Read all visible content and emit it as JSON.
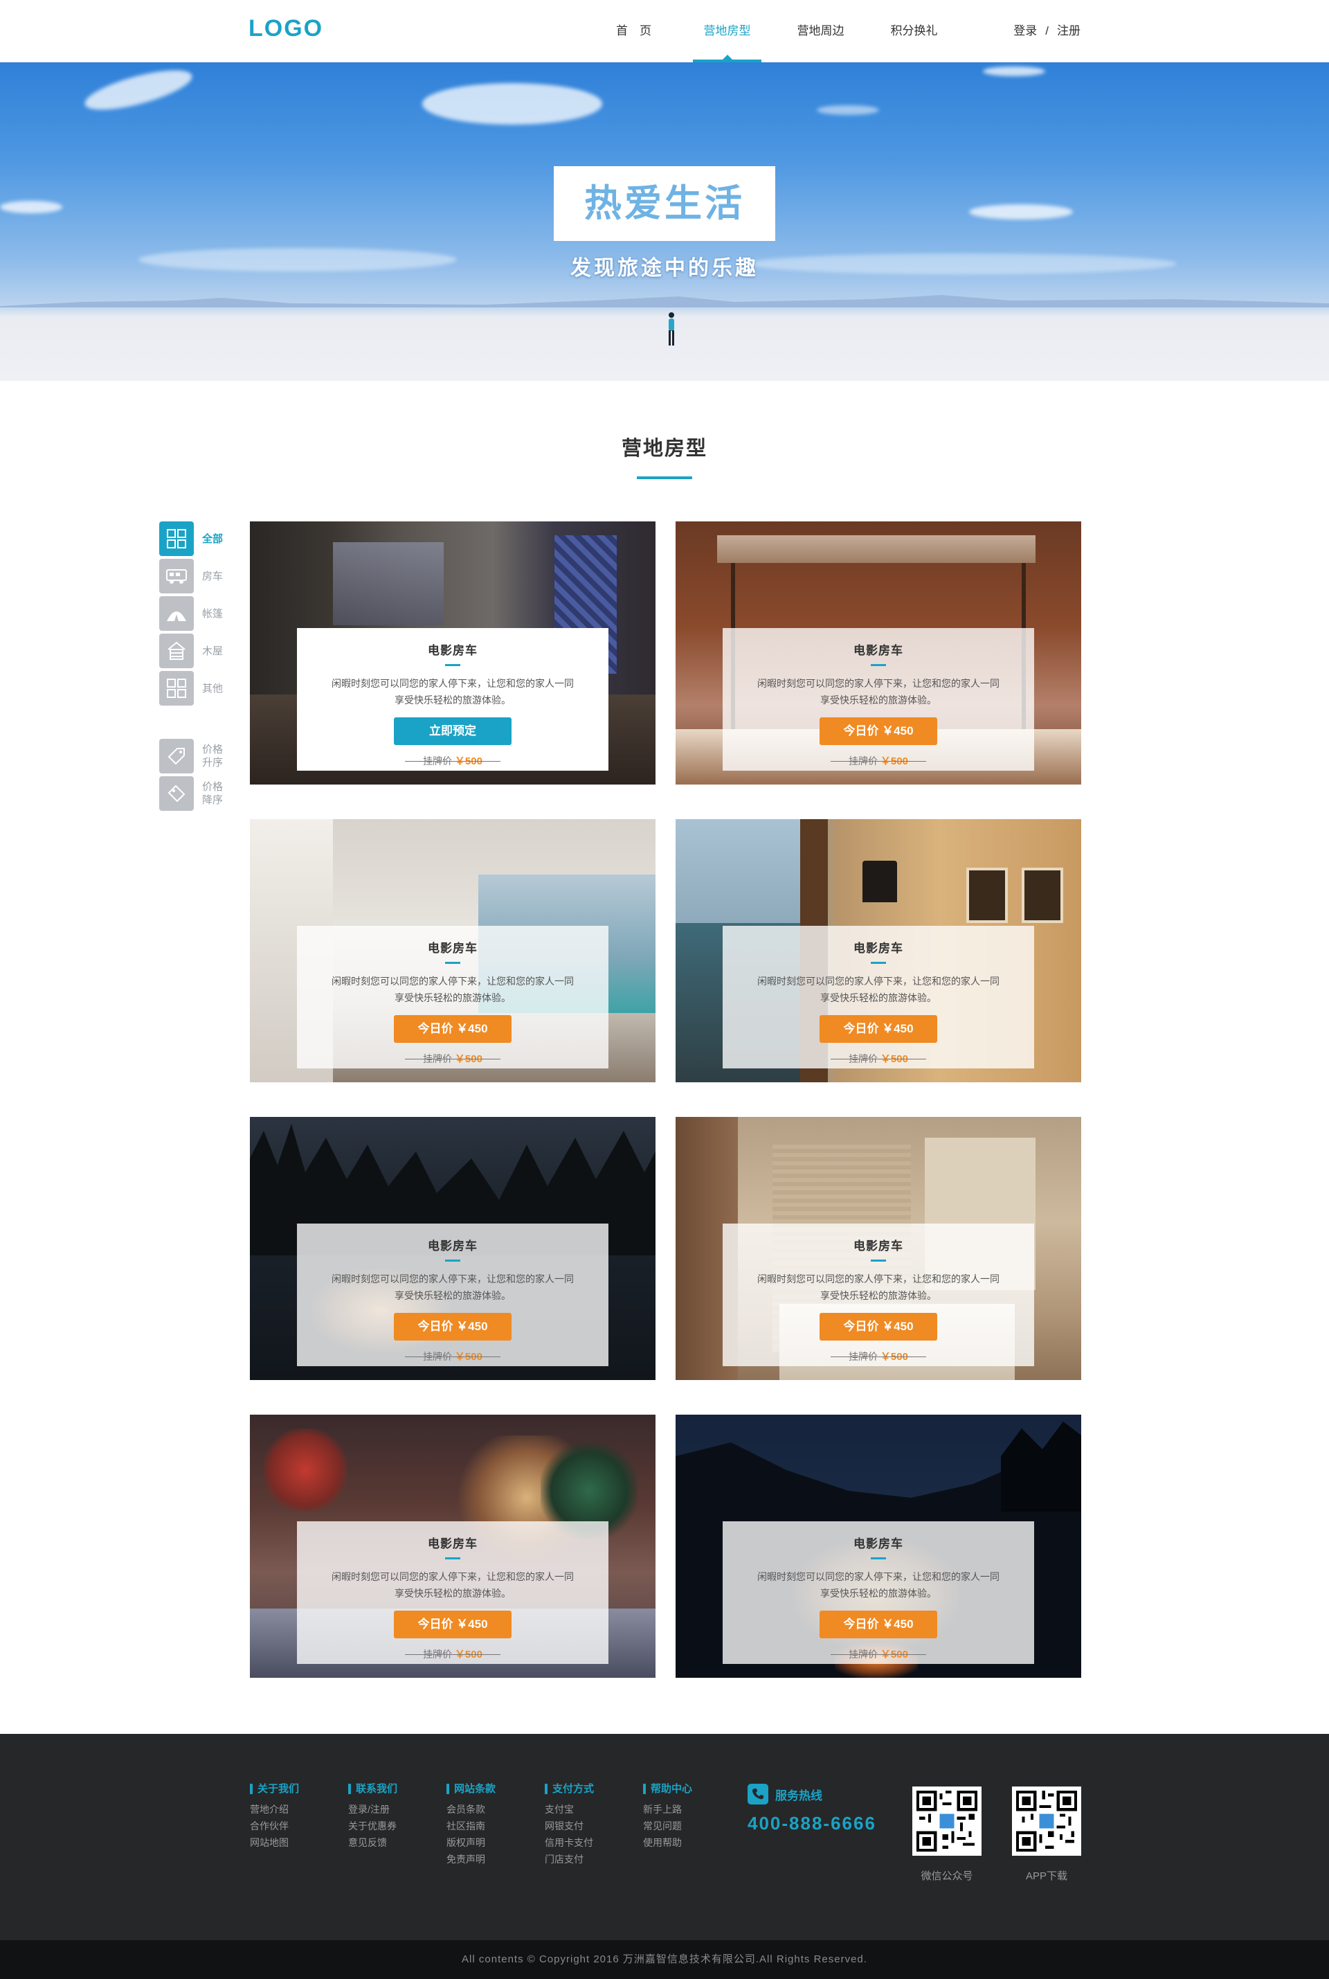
{
  "header": {
    "logo": "LOGO",
    "nav": [
      "首　页",
      "营地房型",
      "营地周边",
      "积分换礼"
    ],
    "login": "登录",
    "separator": "/",
    "register": "注册"
  },
  "hero": {
    "title": "热爱生活",
    "subtitle": "发现旅途中的乐趣"
  },
  "section": {
    "title": "营地房型"
  },
  "filters": [
    {
      "label": "全部",
      "icon": "grid-icon"
    },
    {
      "label": "房车",
      "icon": "rv-icon"
    },
    {
      "label": "帐篷",
      "icon": "tent-icon"
    },
    {
      "label": "木屋",
      "icon": "cabin-icon"
    },
    {
      "label": "其他",
      "icon": "grid-icon"
    },
    {
      "label": "价格升序",
      "icon": "price-tag-icon"
    },
    {
      "label": "价格降序",
      "icon": "price-tag-icon"
    }
  ],
  "cards": [
    {
      "title": "电影房车",
      "desc": "闲暇时刻您可以同您的家人停下来，让您和您的家人一同享受快乐轻松的旅游体验。",
      "button": "立即预定",
      "orig_label": "挂牌价",
      "orig_price": "￥500"
    },
    {
      "title": "电影房车",
      "desc": "闲暇时刻您可以同您的家人停下来，让您和您的家人一同享受快乐轻松的旅游体验。",
      "button": "今日价 ￥450",
      "orig_label": "挂牌价",
      "orig_price": "￥500"
    },
    {
      "title": "电影房车",
      "desc": "闲暇时刻您可以同您的家人停下来，让您和您的家人一同享受快乐轻松的旅游体验。",
      "button": "今日价 ￥450",
      "orig_label": "挂牌价",
      "orig_price": "￥500"
    },
    {
      "title": "电影房车",
      "desc": "闲暇时刻您可以同您的家人停下来，让您和您的家人一同享受快乐轻松的旅游体验。",
      "button": "今日价 ￥450",
      "orig_label": "挂牌价",
      "orig_price": "￥500"
    },
    {
      "title": "电影房车",
      "desc": "闲暇时刻您可以同您的家人停下来，让您和您的家人一同享受快乐轻松的旅游体验。",
      "button": "今日价 ￥450",
      "orig_label": "挂牌价",
      "orig_price": "￥500"
    },
    {
      "title": "电影房车",
      "desc": "闲暇时刻您可以同您的家人停下来，让您和您的家人一同享受快乐轻松的旅游体验。",
      "button": "今日价 ￥450",
      "orig_label": "挂牌价",
      "orig_price": "￥500"
    },
    {
      "title": "电影房车",
      "desc": "闲暇时刻您可以同您的家人停下来，让您和您的家人一同享受快乐轻松的旅游体验。",
      "button": "今日价 ￥450",
      "orig_label": "挂牌价",
      "orig_price": "￥500"
    },
    {
      "title": "电影房车",
      "desc": "闲暇时刻您可以同您的家人停下来，让您和您的家人一同享受快乐轻松的旅游体验。",
      "button": "今日价 ￥450",
      "orig_label": "挂牌价",
      "orig_price": "￥500"
    }
  ],
  "footer": {
    "columns": [
      {
        "title": "关于我们",
        "links": [
          "营地介绍",
          "合作伙伴",
          "网站地图"
        ]
      },
      {
        "title": "联系我们",
        "links": [
          "登录/注册",
          "关于优惠券",
          "意见反馈"
        ]
      },
      {
        "title": "网站条款",
        "links": [
          "会员条款",
          "社区指南",
          "版权声明",
          "免责声明"
        ]
      },
      {
        "title": "支付方式",
        "links": [
          "支付宝",
          "网银支付",
          "信用卡支付",
          "门店支付"
        ]
      },
      {
        "title": "帮助中心",
        "links": [
          "新手上路",
          "常见问题",
          "使用帮助"
        ]
      }
    ],
    "hotline_label": "服务热线",
    "hotline_number": "400-888-6666",
    "qr_wechat": "微信公众号",
    "qr_app": "APP下载",
    "copyright": "All contents © Copyright 2016 万洲嘉智信息技术有限公司.All Rights Reserved."
  },
  "colors": {
    "accent": "#1aa3c6",
    "orange": "#f08a22",
    "footer_bg": "#262728",
    "copyright_bg": "#111213"
  }
}
